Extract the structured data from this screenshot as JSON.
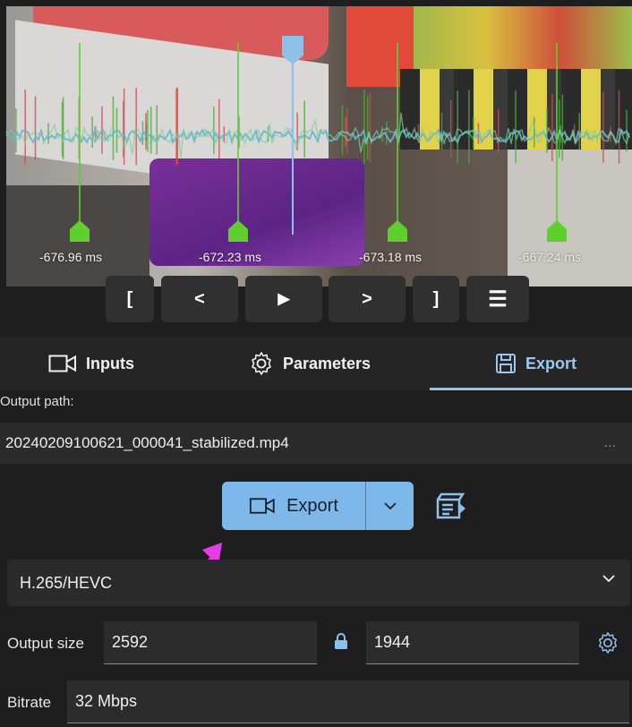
{
  "player": {
    "markers": [
      {
        "label": "-676.96 ms"
      },
      {
        "label": "-672.23 ms"
      },
      {
        "label": "-673.18 ms"
      },
      {
        "label": "-667.24 ms"
      }
    ],
    "controls": {
      "mark_in": "[",
      "prev_frame": "<",
      "play": "▶",
      "next_frame": ">",
      "mark_out": "]",
      "menu": "☰"
    }
  },
  "tabs": {
    "inputs": "Inputs",
    "parameters": "Parameters",
    "export": "Export",
    "active": "export"
  },
  "export": {
    "output_path_label": "Output path:",
    "output_path_value": "20240209100621_000041_stabilized.mp4",
    "browse": "...",
    "export_button": "Export",
    "codec": "H.265/HEVC",
    "output_size_label": "Output size",
    "width": "2592",
    "height": "1944",
    "bitrate_label": "Bitrate",
    "bitrate": "32 Mbps"
  },
  "colors": {
    "accent": "#7eb8ea",
    "marker_green": "#5fcf2e",
    "playhead_blue": "#8fc0ea",
    "annotation_arrow": "#e83ce8"
  }
}
